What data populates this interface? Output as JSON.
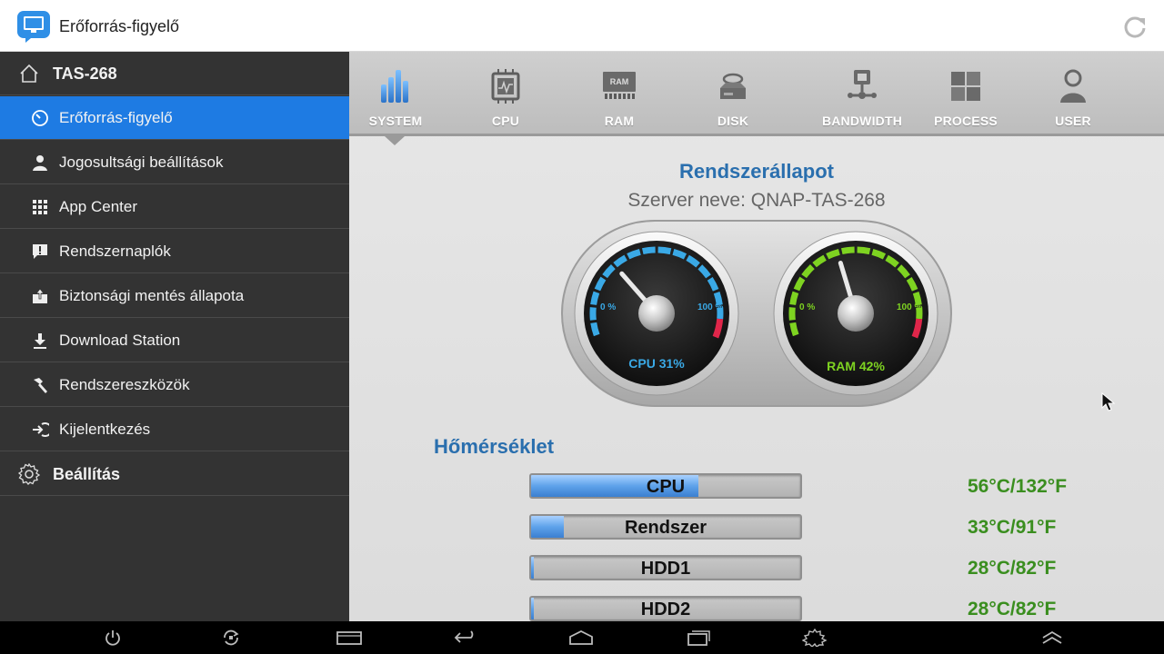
{
  "app": {
    "title": "Erőforrás-figyelő"
  },
  "sidebar": {
    "device": "TAS-268",
    "items": [
      {
        "label": "Erőforrás-figyelő",
        "icon": "speedometer-icon",
        "active": true
      },
      {
        "label": "Jogosultsági beállítások",
        "icon": "user-icon"
      },
      {
        "label": "App Center",
        "icon": "grid-icon"
      },
      {
        "label": "Rendszernaplók",
        "icon": "alert-message-icon"
      },
      {
        "label": "Biztonsági mentés állapota",
        "icon": "backup-icon"
      },
      {
        "label": "Download Station",
        "icon": "download-icon"
      },
      {
        "label": "Rendszereszközök",
        "icon": "hammer-icon"
      },
      {
        "label": "Kijelentkezés",
        "icon": "logout-icon"
      }
    ],
    "settings": "Beállítás"
  },
  "tabs": [
    {
      "label": "SYSTEM",
      "icon": "bar-chart-icon",
      "active": true
    },
    {
      "label": "CPU",
      "icon": "cpu-chip-icon"
    },
    {
      "label": "RAM",
      "icon": "ram-icon"
    },
    {
      "label": "DISK",
      "icon": "disk-icon"
    },
    {
      "label": "BANDWIDTH",
      "icon": "network-icon"
    },
    {
      "label": "PROCESS",
      "icon": "process-icon"
    },
    {
      "label": "USER",
      "icon": "user-icon"
    }
  ],
  "system": {
    "status_title": "Rendszerállapot",
    "server_name": "Szerver neve: QNAP-TAS-268",
    "gauges": [
      {
        "name": "CPU",
        "percent": 31,
        "label": "CPU 31%",
        "min_label": "0 %",
        "max_label": "100 %",
        "color": "#3aa9e6"
      },
      {
        "name": "RAM",
        "percent": 42,
        "label": "RAM 42%",
        "min_label": "0 %",
        "max_label": "100 %",
        "color": "#7ed321"
      }
    ],
    "temperature_title": "Hőmérséklet",
    "temperatures": [
      {
        "name": "CPU",
        "value": "56°C/132°F",
        "fill": 0.62
      },
      {
        "name": "Rendszer",
        "value": "33°C/91°F",
        "fill": 0.12
      },
      {
        "name": "HDD1",
        "value": "28°C/82°F",
        "fill": 0.01
      },
      {
        "name": "HDD2",
        "value": "28°C/82°F",
        "fill": 0.01
      }
    ]
  },
  "navbar": [
    "power-icon",
    "settings-sync-icon",
    "window-icon",
    "back-icon",
    "home-icon",
    "recent-apps-icon",
    "gear-icon",
    "expand-up-icon"
  ],
  "colors": {
    "accent": "#1e7be3",
    "temp_green": "#3a8e1f",
    "title_blue": "#2a6fae"
  }
}
